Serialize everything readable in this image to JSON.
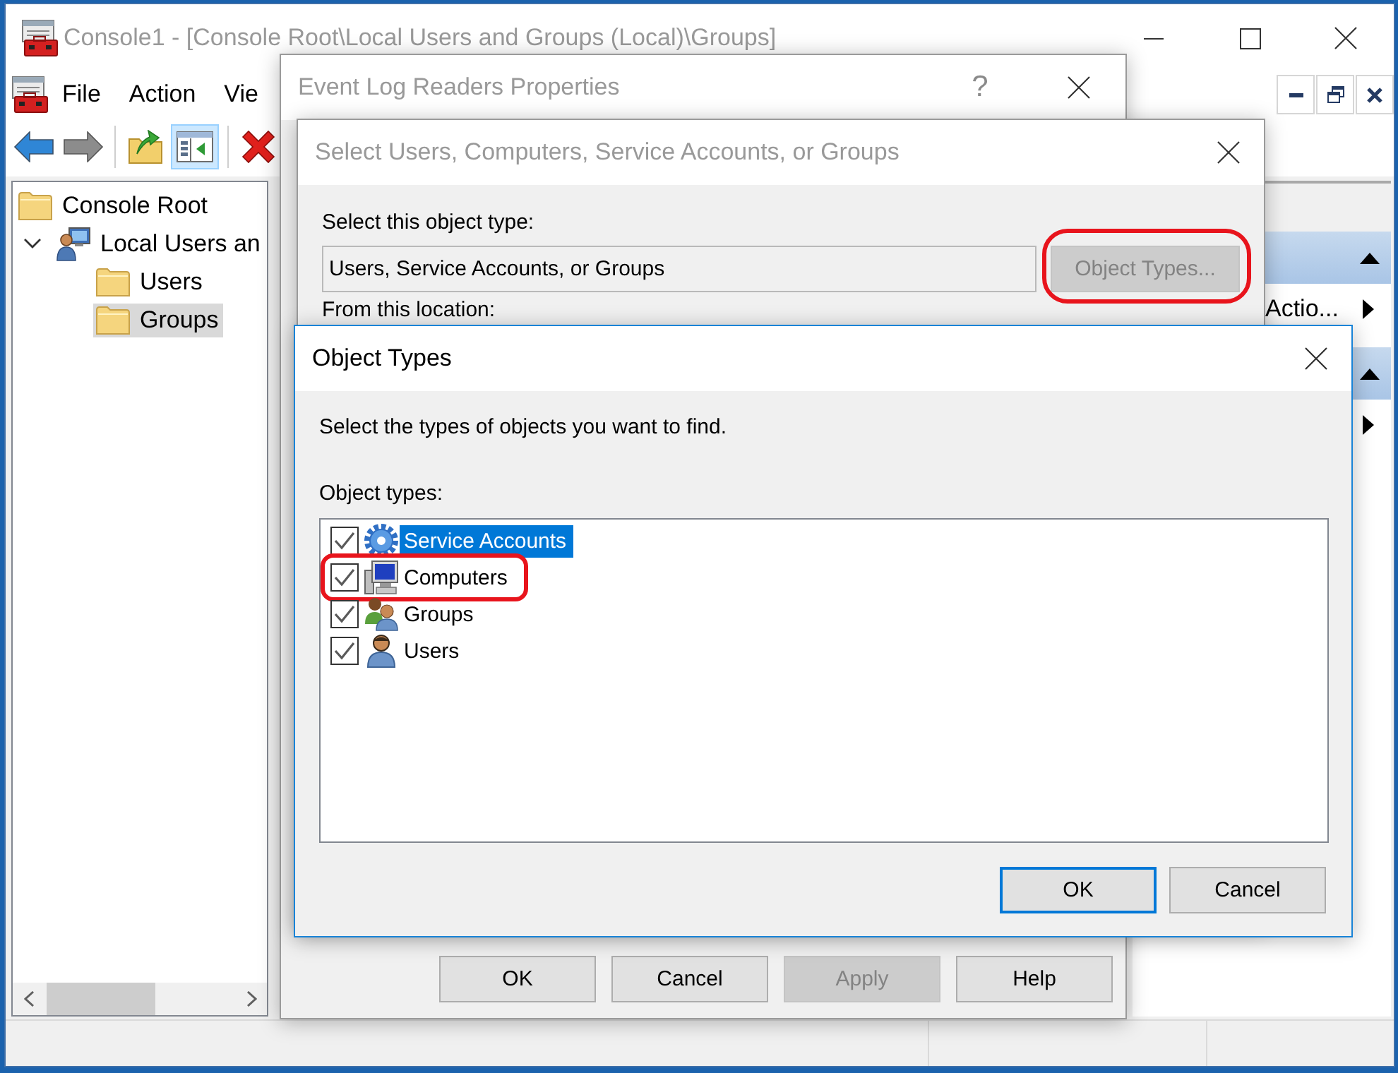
{
  "main_window": {
    "title": "Console1 - [Console Root\\Local Users and Groups (Local)\\Groups]",
    "active": false,
    "menu": [
      {
        "label": "File"
      },
      {
        "label": "Action"
      },
      {
        "label": "Vie"
      }
    ],
    "toolbar": [
      [
        {
          "kind": "back",
          "disabled": false,
          "pressed": false
        },
        {
          "kind": "forward",
          "disabled": true,
          "pressed": false
        }
      ],
      [
        {
          "kind": "up",
          "disabled": false,
          "pressed": false
        },
        {
          "kind": "console_tree",
          "disabled": false,
          "pressed": true
        }
      ],
      [
        {
          "kind": "delete",
          "disabled": false,
          "pressed": false
        }
      ]
    ],
    "tree": [
      {
        "label": "Console Root",
        "kind": "folder",
        "selected": false,
        "children": [
          {
            "label": "Local Users an",
            "kind": "computer_user",
            "selected": false,
            "expanded": true,
            "children": [
              {
                "label": "Users",
                "kind": "folder",
                "selected": false
              },
              {
                "label": "Groups",
                "kind": "folder",
                "selected": true
              }
            ]
          }
        ]
      }
    ],
    "actions_pane": {
      "sections": [
        {
          "expanded": true,
          "items": [
            {
              "label": "Actio...",
              "submenu": true
            }
          ]
        },
        {
          "expanded": true,
          "items": [
            {
              "submenu": true
            }
          ]
        }
      ]
    }
  },
  "properties_dialog": {
    "title": "Event Log Readers Properties",
    "active": false,
    "help": "?",
    "buttons": [
      {
        "label": "OK",
        "disabled": false
      },
      {
        "label": "Cancel",
        "disabled": false
      },
      {
        "label": "Apply",
        "disabled": true
      },
      {
        "label": "Help",
        "disabled": false
      }
    ]
  },
  "select_dialog": {
    "title": "Select Users, Computers, Service Accounts, or Groups",
    "active": false,
    "object_type_label": "Select this object type:",
    "object_type_value": "Users, Service Accounts, or Groups",
    "object_types_button": {
      "label": "Object Types...",
      "disabled": true,
      "highlighted": true
    },
    "location_label": "From this location:"
  },
  "object_types_dialog": {
    "title": "Object Types",
    "active": true,
    "prompt": "Select the types of objects you want to find.",
    "list_label": "Object types:",
    "types": [
      {
        "label": "Service Accounts",
        "kind": "service_account",
        "checked": true,
        "selected": true,
        "highlighted": false
      },
      {
        "label": "Computers",
        "kind": "computer",
        "checked": true,
        "selected": false,
        "highlighted": true
      },
      {
        "label": "Groups",
        "kind": "group",
        "checked": true,
        "selected": false,
        "highlighted": false
      },
      {
        "label": "Users",
        "kind": "user",
        "checked": true,
        "selected": false,
        "highlighted": false
      }
    ],
    "buttons": [
      {
        "label": "OK",
        "default": true
      },
      {
        "label": "Cancel",
        "default": false
      }
    ]
  }
}
